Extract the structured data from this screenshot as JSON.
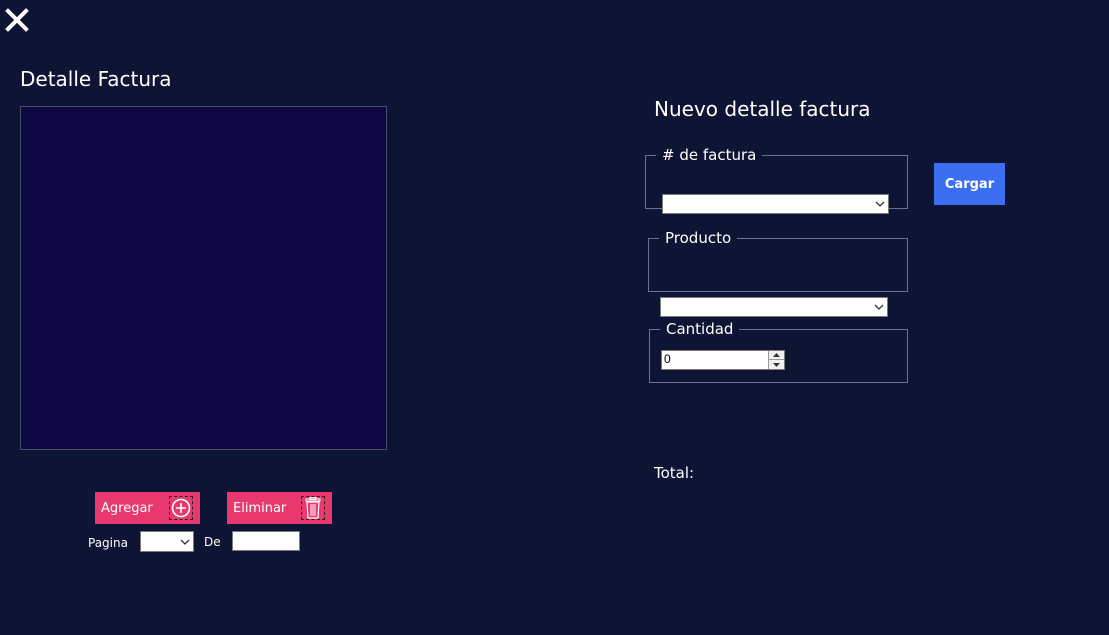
{
  "window": {
    "close_icon": "close-icon"
  },
  "left": {
    "title": "Detalle Factura",
    "add_label": "Agregar",
    "delete_label": "Eliminar",
    "page_label": "Pagina",
    "of_label": "De",
    "page_value": "",
    "total_pages_value": ""
  },
  "right": {
    "title": "Nuevo detalle factura",
    "invoice_group_label": "# de factura",
    "invoice_value": "",
    "load_label": "Cargar",
    "product_group_label": "Producto",
    "product_value": "",
    "quantity_group_label": "Cantidad",
    "quantity_value": "0",
    "total_label": "Total:"
  },
  "colors": {
    "background": "#0e1433",
    "grid": "#0d0844",
    "accent_pink": "#e8396e",
    "accent_blue": "#3b6ef0"
  }
}
